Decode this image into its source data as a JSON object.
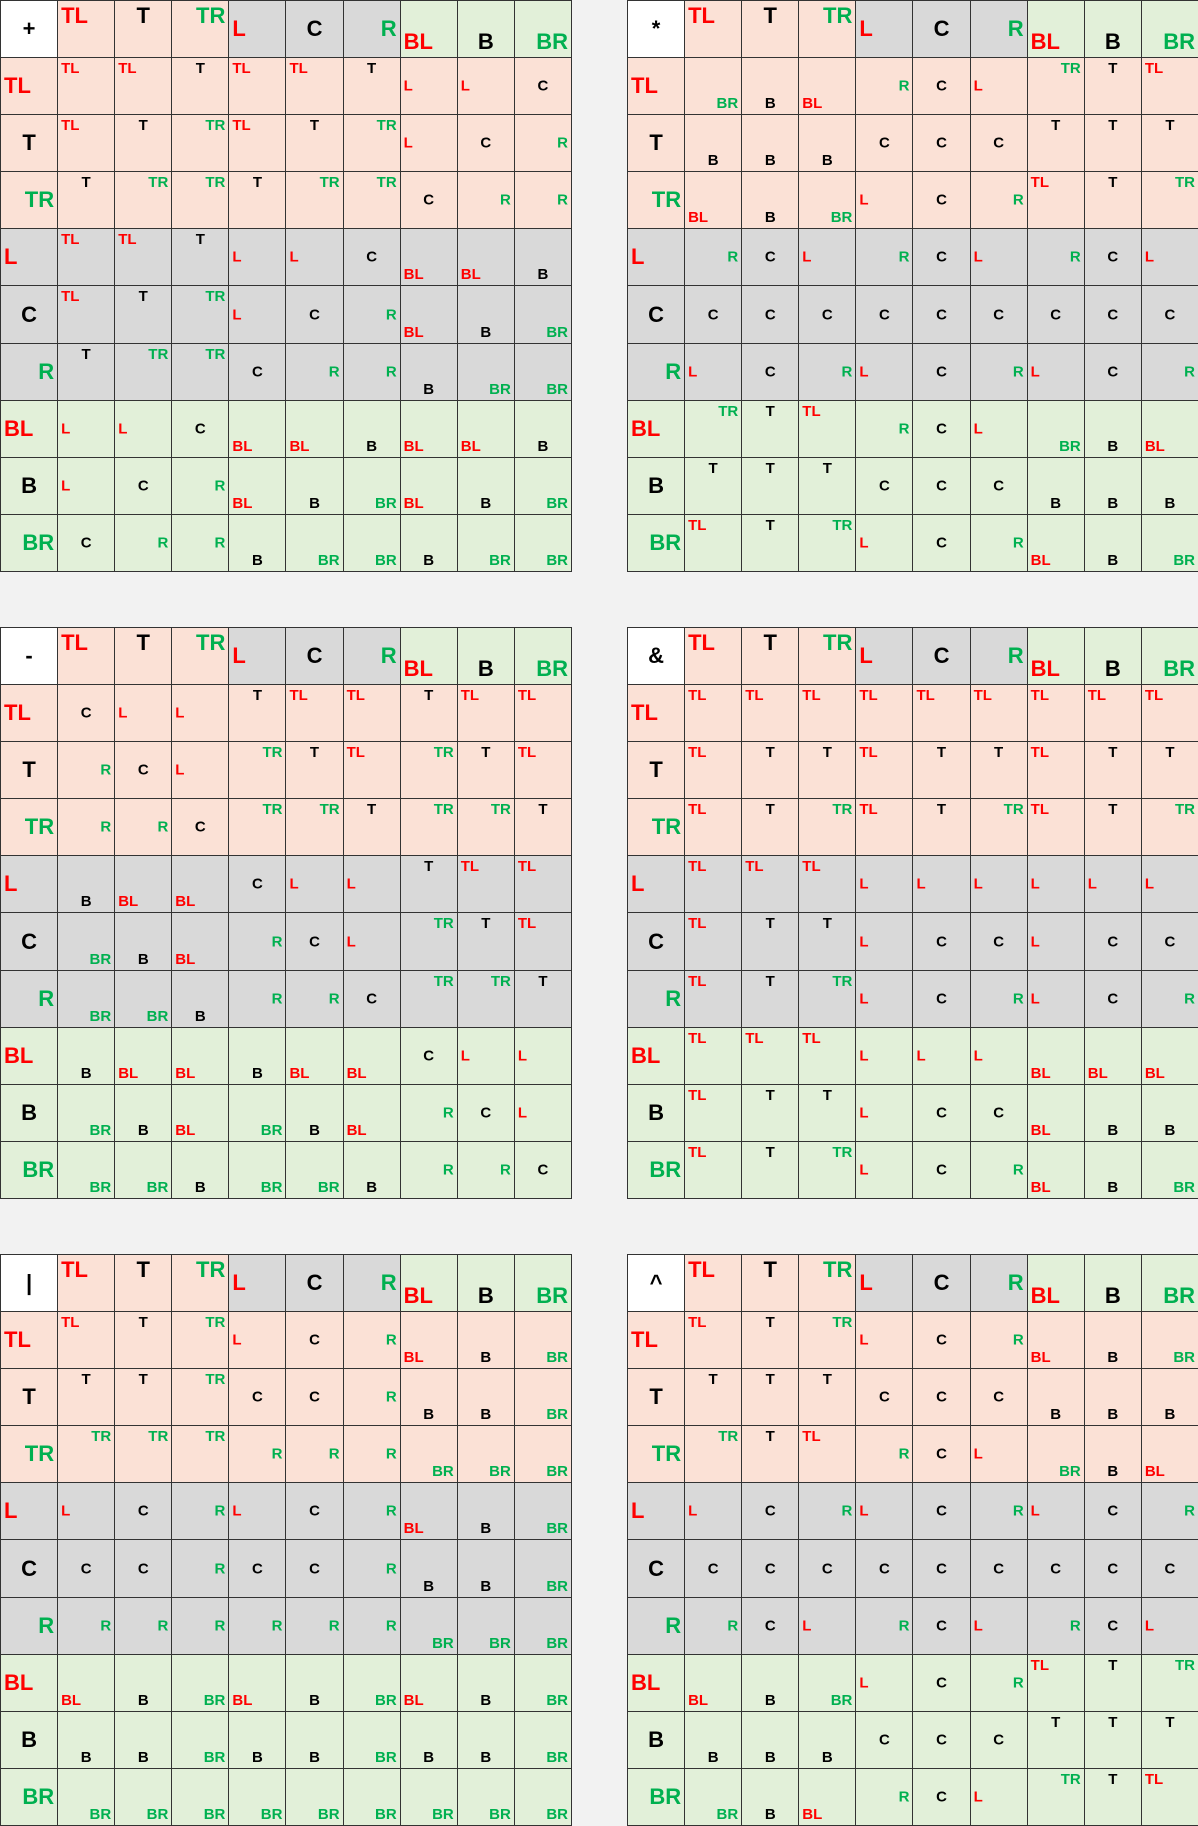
{
  "axis_labels": [
    "TL",
    "T",
    "TR",
    "L",
    "C",
    "R",
    "BL",
    "B",
    "BR"
  ],
  "tables": [
    {
      "symbol": "+",
      "rows": [
        [
          "TL",
          "TL",
          "T",
          "TL",
          "TL",
          "T",
          "L",
          "L",
          "C"
        ],
        [
          "TL",
          "T",
          "TR",
          "TL",
          "T",
          "TR",
          "L",
          "C",
          "R"
        ],
        [
          "T",
          "TR",
          "TR",
          "T",
          "TR",
          "TR",
          "C",
          "R",
          "R"
        ],
        [
          "TL",
          "TL",
          "T",
          "L",
          "L",
          "C",
          "BL",
          "BL",
          "B"
        ],
        [
          "TL",
          "T",
          "TR",
          "L",
          "C",
          "R",
          "BL",
          "B",
          "BR"
        ],
        [
          "T",
          "TR",
          "TR",
          "C",
          "R",
          "R",
          "B",
          "BR",
          "BR"
        ],
        [
          "L",
          "L",
          "C",
          "BL",
          "BL",
          "B",
          "BL",
          "BL",
          "B"
        ],
        [
          "L",
          "C",
          "R",
          "BL",
          "B",
          "BR",
          "BL",
          "B",
          "BR"
        ],
        [
          "C",
          "R",
          "R",
          "B",
          "BR",
          "BR",
          "B",
          "BR",
          "BR"
        ]
      ]
    },
    {
      "symbol": "*",
      "rows": [
        [
          "BR",
          "B",
          "BL",
          "R",
          "C",
          "L",
          "TR",
          "T",
          "TL"
        ],
        [
          "B",
          "B",
          "B",
          "C",
          "C",
          "C",
          "T",
          "T",
          "T"
        ],
        [
          "BL",
          "B",
          "BR",
          "L",
          "C",
          "R",
          "TL",
          "T",
          "TR"
        ],
        [
          "R",
          "C",
          "L",
          "R",
          "C",
          "L",
          "R",
          "C",
          "L"
        ],
        [
          "C",
          "C",
          "C",
          "C",
          "C",
          "C",
          "C",
          "C",
          "C"
        ],
        [
          "L",
          "C",
          "R",
          "L",
          "C",
          "R",
          "L",
          "C",
          "R"
        ],
        [
          "TR",
          "T",
          "TL",
          "R",
          "C",
          "L",
          "BR",
          "B",
          "BL"
        ],
        [
          "T",
          "T",
          "T",
          "C",
          "C",
          "C",
          "B",
          "B",
          "B"
        ],
        [
          "TL",
          "T",
          "TR",
          "L",
          "C",
          "R",
          "BL",
          "B",
          "BR"
        ]
      ]
    },
    {
      "symbol": "-",
      "rows": [
        [
          "C",
          "L",
          "L",
          "T",
          "TL",
          "TL",
          "T",
          "TL",
          "TL"
        ],
        [
          "R",
          "C",
          "L",
          "TR",
          "T",
          "TL",
          "TR",
          "T",
          "TL"
        ],
        [
          "R",
          "R",
          "C",
          "TR",
          "TR",
          "T",
          "TR",
          "TR",
          "T"
        ],
        [
          "B",
          "BL",
          "BL",
          "C",
          "L",
          "L",
          "T",
          "TL",
          "TL"
        ],
        [
          "BR",
          "B",
          "BL",
          "R",
          "C",
          "L",
          "TR",
          "T",
          "TL"
        ],
        [
          "BR",
          "BR",
          "B",
          "R",
          "R",
          "C",
          "TR",
          "TR",
          "T"
        ],
        [
          "B",
          "BL",
          "BL",
          "B",
          "BL",
          "BL",
          "C",
          "L",
          "L"
        ],
        [
          "BR",
          "B",
          "BL",
          "BR",
          "B",
          "BL",
          "R",
          "C",
          "L"
        ],
        [
          "BR",
          "BR",
          "B",
          "BR",
          "BR",
          "B",
          "R",
          "R",
          "C"
        ]
      ]
    },
    {
      "symbol": "&",
      "rows": [
        [
          "TL",
          "TL",
          "TL",
          "TL",
          "TL",
          "TL",
          "TL",
          "TL",
          "TL"
        ],
        [
          "TL",
          "T",
          "T",
          "TL",
          "T",
          "T",
          "TL",
          "T",
          "T"
        ],
        [
          "TL",
          "T",
          "TR",
          "TL",
          "T",
          "TR",
          "TL",
          "T",
          "TR"
        ],
        [
          "TL",
          "TL",
          "TL",
          "L",
          "L",
          "L",
          "L",
          "L",
          "L"
        ],
        [
          "TL",
          "T",
          "T",
          "L",
          "C",
          "C",
          "L",
          "C",
          "C"
        ],
        [
          "TL",
          "T",
          "TR",
          "L",
          "C",
          "R",
          "L",
          "C",
          "R"
        ],
        [
          "TL",
          "TL",
          "TL",
          "L",
          "L",
          "L",
          "BL",
          "BL",
          "BL"
        ],
        [
          "TL",
          "T",
          "T",
          "L",
          "C",
          "C",
          "BL",
          "B",
          "B"
        ],
        [
          "TL",
          "T",
          "TR",
          "L",
          "C",
          "R",
          "BL",
          "B",
          "BR"
        ]
      ]
    },
    {
      "symbol": "|",
      "rows": [
        [
          "TL",
          "T",
          "TR",
          "L",
          "C",
          "R",
          "BL",
          "B",
          "BR"
        ],
        [
          "T",
          "T",
          "TR",
          "C",
          "C",
          "R",
          "B",
          "B",
          "BR"
        ],
        [
          "TR",
          "TR",
          "TR",
          "R",
          "R",
          "R",
          "BR",
          "BR",
          "BR"
        ],
        [
          "L",
          "C",
          "R",
          "L",
          "C",
          "R",
          "BL",
          "B",
          "BR"
        ],
        [
          "C",
          "C",
          "R",
          "C",
          "C",
          "R",
          "B",
          "B",
          "BR"
        ],
        [
          "R",
          "R",
          "R",
          "R",
          "R",
          "R",
          "BR",
          "BR",
          "BR"
        ],
        [
          "BL",
          "B",
          "BR",
          "BL",
          "B",
          "BR",
          "BL",
          "B",
          "BR"
        ],
        [
          "B",
          "B",
          "BR",
          "B",
          "B",
          "BR",
          "B",
          "B",
          "BR"
        ],
        [
          "BR",
          "BR",
          "BR",
          "BR",
          "BR",
          "BR",
          "BR",
          "BR",
          "BR"
        ]
      ]
    },
    {
      "symbol": "^",
      "rows": [
        [
          "TL",
          "T",
          "TR",
          "L",
          "C",
          "R",
          "BL",
          "B",
          "BR"
        ],
        [
          "T",
          "T",
          "T",
          "C",
          "C",
          "C",
          "B",
          "B",
          "B"
        ],
        [
          "TR",
          "T",
          "TL",
          "R",
          "C",
          "L",
          "BR",
          "B",
          "BL"
        ],
        [
          "L",
          "C",
          "R",
          "L",
          "C",
          "R",
          "L",
          "C",
          "R"
        ],
        [
          "C",
          "C",
          "C",
          "C",
          "C",
          "C",
          "C",
          "C",
          "C"
        ],
        [
          "R",
          "C",
          "L",
          "R",
          "C",
          "L",
          "R",
          "C",
          "L"
        ],
        [
          "BL",
          "B",
          "BR",
          "L",
          "C",
          "R",
          "TL",
          "T",
          "TR"
        ],
        [
          "B",
          "B",
          "B",
          "C",
          "C",
          "C",
          "T",
          "T",
          "T"
        ],
        [
          "BR",
          "B",
          "BL",
          "R",
          "C",
          "L",
          "TR",
          "T",
          "TL"
        ]
      ]
    }
  ]
}
